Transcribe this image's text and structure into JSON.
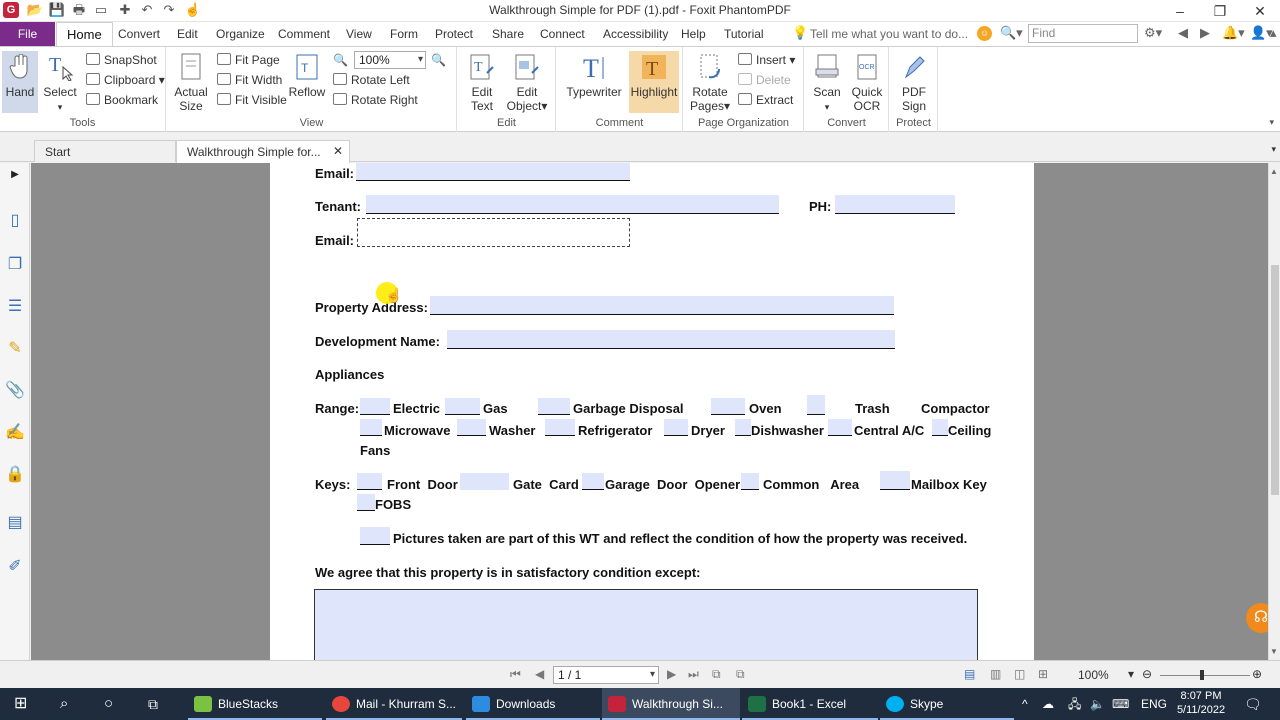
{
  "titlebar": {
    "title": "Walkthrough Simple for PDF (1).pdf - Foxit PhantomPDF",
    "logo": "G"
  },
  "menu": {
    "file": "File",
    "items": [
      "Home",
      "Convert",
      "Edit",
      "Organize",
      "Comment",
      "View",
      "Form",
      "Protect",
      "Share",
      "Connect",
      "Accessibility",
      "Help",
      "Tutorial"
    ],
    "tell_me": "Tell me what you want to do...",
    "find_placeholder": "Find"
  },
  "ribbon": {
    "tools": {
      "label": "Tools",
      "hand": "Hand",
      "select": "Select",
      "snapshot": "SnapShot",
      "clipboard": "Clipboard",
      "bookmark": "Bookmark"
    },
    "view": {
      "label": "View",
      "actual_size_1": "Actual",
      "actual_size_2": "Size",
      "fit_page": "Fit Page",
      "fit_width": "Fit Width",
      "fit_visible": "Fit Visible",
      "reflow": "Reflow",
      "zoom": "100%",
      "rotate_left": "Rotate Left",
      "rotate_right": "Rotate Right"
    },
    "edit": {
      "label": "Edit",
      "edit_text_1": "Edit",
      "edit_text_2": "Text",
      "edit_object_1": "Edit",
      "edit_object_2": "Object"
    },
    "comment": {
      "label": "Comment",
      "typewriter": "Typewriter",
      "highlight": "Highlight"
    },
    "page_org": {
      "label": "Page Organization",
      "rotate_pages_1": "Rotate",
      "rotate_pages_2": "Pages",
      "insert": "Insert",
      "delete": "Delete",
      "extract": "Extract"
    },
    "convert": {
      "label": "Convert",
      "scan": "Scan",
      "quick_ocr_1": "Quick",
      "quick_ocr_2": "OCR"
    },
    "protect": {
      "label": "Protect",
      "pdf_sign_1": "PDF",
      "pdf_sign_2": "Sign"
    }
  },
  "tabs": {
    "start": "Start",
    "doc": "Walkthrough Simple for..."
  },
  "document": {
    "email1": "Email:",
    "tenant": "Tenant:",
    "ph": "PH:",
    "email2": "Email:",
    "property_address": "Property Address:",
    "development_name": "Development Name:",
    "appliances": "Appliances",
    "range": "Range:",
    "electric": "Electric",
    "gas": "Gas",
    "garbage_disposal": "Garbage Disposal",
    "oven": "Oven",
    "trash": "Trash",
    "compactor": "Compactor",
    "microwave": "Microwave",
    "washer": "Washer",
    "refrigerator": "Refrigerator",
    "dryer": "Dryer",
    "dishwasher": "Dishwasher",
    "central_ac": "Central A/C",
    "ceiling": "Ceiling",
    "fans": "Fans",
    "keys": "Keys:",
    "front_door": "Front",
    "front_door_2": "Door",
    "gate_card": "Gate",
    "gate_card_2": "Card",
    "garage_door_opener": "Garage",
    "garage_2": "Door",
    "garage_3": "Opener",
    "common_area": "Common",
    "common_area_2": "Area",
    "mailbox_key": "Mailbox Key",
    "fobs": "FOBS",
    "pictures": "Pictures taken are part of this WT and reflect the condition of how the property was received.",
    "agree": "We agree that this property is in satisfactory condition except:"
  },
  "statusbar": {
    "page": "1 / 1",
    "zoom": "100%"
  },
  "taskbar": {
    "apps": [
      "BlueStacks",
      "Mail - Khurram S...",
      "Downloads",
      "Walkthrough Si...",
      "Book1 - Excel",
      "Skype"
    ],
    "lang": "ENG",
    "time": "8:07 PM",
    "date": "5/11/2022"
  },
  "colors": {
    "file_tab": "#7b2c8a",
    "form_field": "#dfe5fa",
    "taskbar": "#1f2c3d"
  }
}
